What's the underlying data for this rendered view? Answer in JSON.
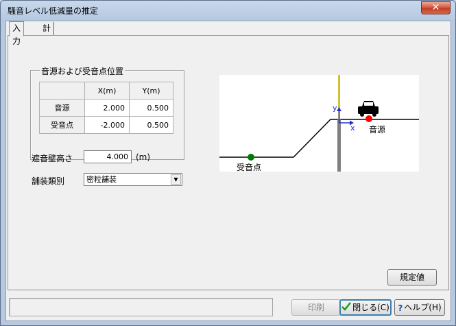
{
  "window": {
    "title": "騒音レベル低減量の推定",
    "close_label": "✕"
  },
  "tabs": [
    {
      "label": "入力"
    },
    {
      "label": "計算結果"
    }
  ],
  "position_group": {
    "title": "音源および受音点位置",
    "columns": [
      "",
      "X(m)",
      "Y(m)"
    ],
    "rows": [
      {
        "name": "音源",
        "x": "2.000",
        "y": "0.500"
      },
      {
        "name": "受音点",
        "x": "-2.000",
        "y": "0.500"
      }
    ]
  },
  "wall_height": {
    "label": "遮音壁高さ",
    "value": "4.000",
    "unit": "(m)"
  },
  "pavement": {
    "label": "舗装類別",
    "selected": "密粒舗装"
  },
  "diagram": {
    "source_label": "音源",
    "receiver_label": "受音点",
    "axis_x": "x",
    "axis_y": "y",
    "colors": {
      "source": "#ff0000",
      "receiver": "#007a00",
      "wall": "#808080",
      "wall_top": "#c8b400",
      "axis": "#2030d0"
    }
  },
  "buttons": {
    "defaults": "規定値",
    "print": "印刷",
    "close": "閉じる(C)",
    "help": "ヘルプ(H)"
  }
}
